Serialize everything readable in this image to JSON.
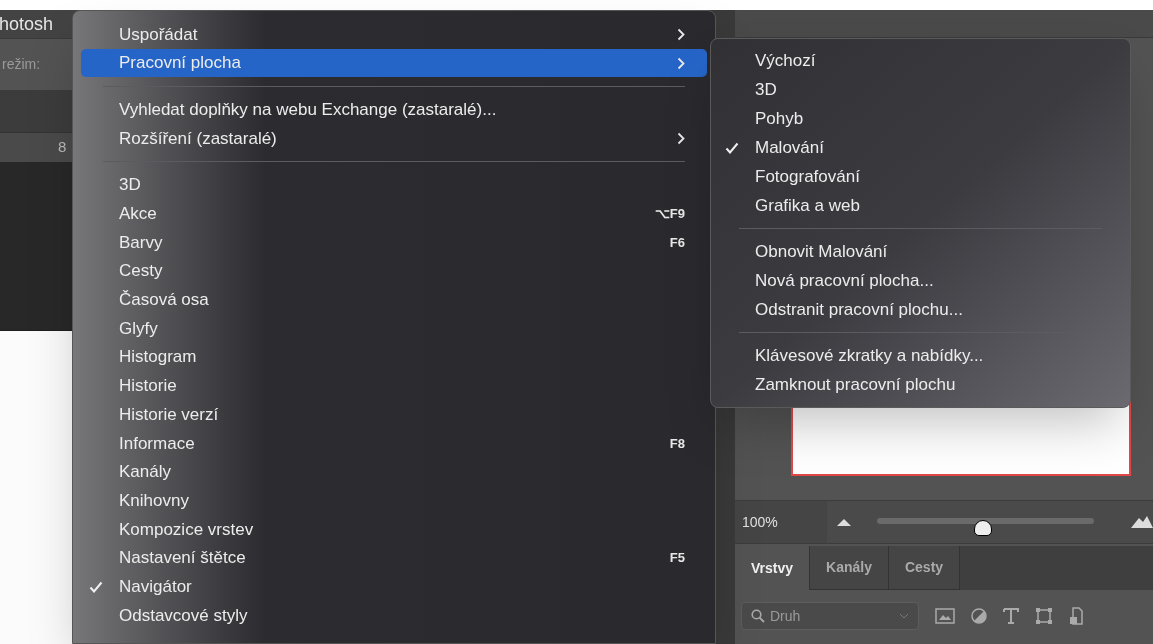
{
  "app": {
    "title_fragment": "hotosh",
    "mode_label": "režim:",
    "ruler_mark": "8"
  },
  "menu": {
    "items": [
      {
        "kind": "item",
        "label": "Uspořádat",
        "submenu": true,
        "selected": false,
        "checked": false
      },
      {
        "kind": "item",
        "label": "Pracovní plocha",
        "submenu": true,
        "selected": true,
        "checked": false
      },
      {
        "kind": "separator"
      },
      {
        "kind": "item",
        "label": "Vyhledat doplňky na webu Exchange (zastaralé)...",
        "submenu": false,
        "selected": false,
        "checked": false
      },
      {
        "kind": "item",
        "label": "Rozšíření (zastaralé)",
        "submenu": true,
        "selected": false,
        "checked": false
      },
      {
        "kind": "separator"
      },
      {
        "kind": "item",
        "label": "3D",
        "submenu": false,
        "selected": false,
        "checked": false
      },
      {
        "kind": "item",
        "label": "Akce",
        "shortcut": "⌥F9",
        "submenu": false,
        "selected": false,
        "checked": false
      },
      {
        "kind": "item",
        "label": "Barvy",
        "shortcut": "F6",
        "submenu": false,
        "selected": false,
        "checked": false
      },
      {
        "kind": "item",
        "label": "Cesty",
        "submenu": false,
        "selected": false,
        "checked": false
      },
      {
        "kind": "item",
        "label": "Časová osa",
        "submenu": false,
        "selected": false,
        "checked": false
      },
      {
        "kind": "item",
        "label": "Glyfy",
        "submenu": false,
        "selected": false,
        "checked": false
      },
      {
        "kind": "item",
        "label": "Histogram",
        "submenu": false,
        "selected": false,
        "checked": false
      },
      {
        "kind": "item",
        "label": "Historie",
        "submenu": false,
        "selected": false,
        "checked": false
      },
      {
        "kind": "item",
        "label": "Historie verzí",
        "submenu": false,
        "selected": false,
        "checked": false
      },
      {
        "kind": "item",
        "label": "Informace",
        "shortcut": "F8",
        "submenu": false,
        "selected": false,
        "checked": false
      },
      {
        "kind": "item",
        "label": "Kanály",
        "submenu": false,
        "selected": false,
        "checked": false
      },
      {
        "kind": "item",
        "label": "Knihovny",
        "submenu": false,
        "selected": false,
        "checked": false
      },
      {
        "kind": "item",
        "label": "Kompozice vrstev",
        "submenu": false,
        "selected": false,
        "checked": false
      },
      {
        "kind": "item",
        "label": "Nastavení štětce",
        "shortcut": "F5",
        "submenu": false,
        "selected": false,
        "checked": false
      },
      {
        "kind": "item",
        "label": "Navigátor",
        "submenu": false,
        "selected": false,
        "checked": true
      },
      {
        "kind": "item",
        "label": "Odstavcové styly",
        "submenu": false,
        "selected": false,
        "checked": false
      }
    ]
  },
  "submenu": {
    "items": [
      {
        "kind": "item",
        "label": "Výchozí",
        "checked": false
      },
      {
        "kind": "item",
        "label": "3D",
        "checked": false
      },
      {
        "kind": "item",
        "label": "Pohyb",
        "checked": false
      },
      {
        "kind": "item",
        "label": "Malování",
        "checked": true
      },
      {
        "kind": "item",
        "label": "Fotografování",
        "checked": false
      },
      {
        "kind": "item",
        "label": "Grafika a web",
        "checked": false
      },
      {
        "kind": "separator"
      },
      {
        "kind": "item",
        "label": "Obnovit Malování",
        "checked": false
      },
      {
        "kind": "item",
        "label": "Nová pracovní plocha...",
        "checked": false
      },
      {
        "kind": "item",
        "label": "Odstranit pracovní plochu...",
        "checked": false
      },
      {
        "kind": "separator"
      },
      {
        "kind": "item",
        "label": "Klávesové zkratky a nabídky...",
        "checked": false
      },
      {
        "kind": "item",
        "label": "Zamknout pracovní plochu",
        "checked": false
      }
    ]
  },
  "navigator": {
    "zoom": "100%",
    "level": 0.49
  },
  "panel_tabs": [
    {
      "label": "Vrstvy",
      "selected": true
    },
    {
      "label": "Kanály",
      "selected": false
    },
    {
      "label": "Cesty",
      "selected": false
    }
  ],
  "layer_filter": {
    "placeholder": "Druh"
  }
}
